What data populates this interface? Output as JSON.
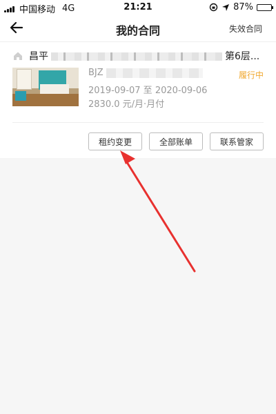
{
  "status_bar": {
    "carrier": "中国移动",
    "network": "4G",
    "time": "21:21",
    "battery": "87%",
    "battery_level": 0.87
  },
  "nav": {
    "title": "我的合同",
    "right_label": "失效合同",
    "back_icon": "arrow-left-icon"
  },
  "contract": {
    "address_prefix": "昌平",
    "address_suffix": "第6层...",
    "id_prefix": "BJZ",
    "dates": "2019-09-07 至 2020-09-06",
    "price": "2830.0 元/月·月付",
    "status": "履行中",
    "status_color": "#f0a830"
  },
  "actions": {
    "change": "租约变更",
    "bills": "全部账单",
    "contact": "联系管家"
  },
  "annotation": {
    "arrow_color": "#e8312f"
  }
}
